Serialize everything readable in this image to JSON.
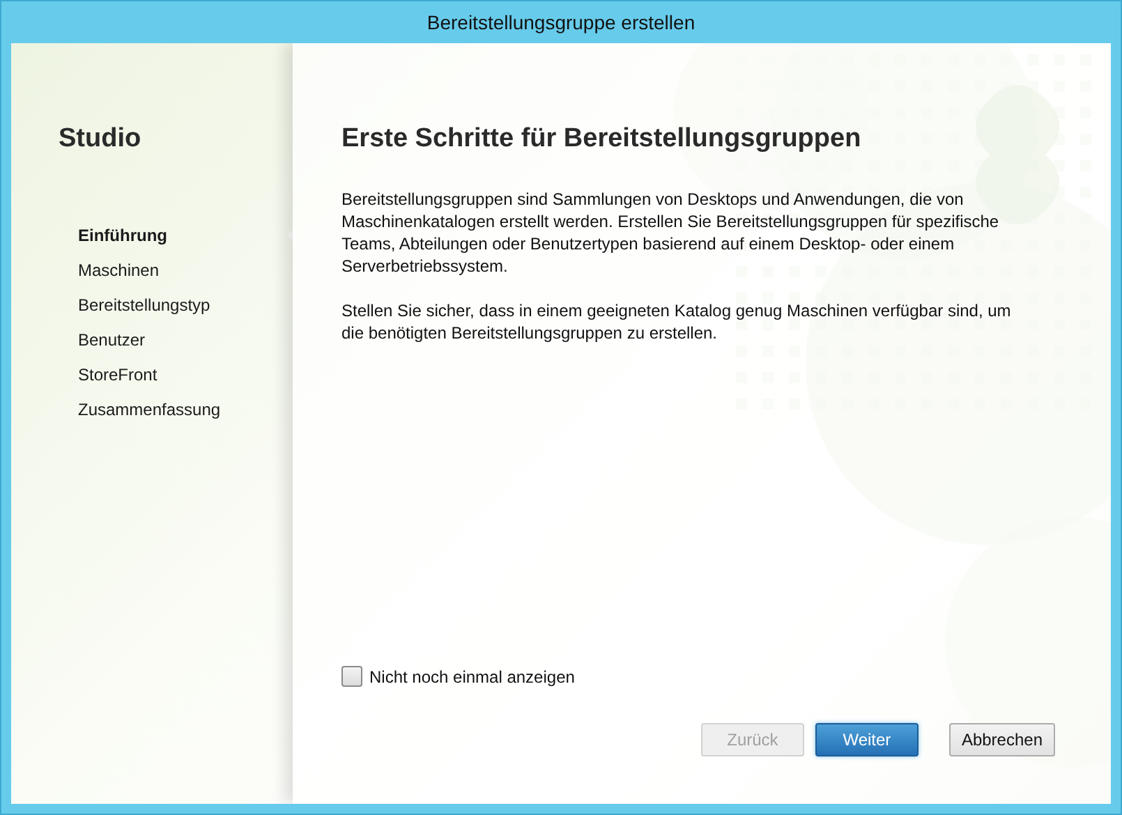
{
  "window": {
    "title": "Bereitstellungsgruppe erstellen"
  },
  "sidebar": {
    "title": "Studio",
    "items": [
      {
        "label": "Einführung",
        "selected": true
      },
      {
        "label": "Maschinen",
        "selected": false
      },
      {
        "label": "Bereitstellungstyp",
        "selected": false
      },
      {
        "label": "Benutzer",
        "selected": false
      },
      {
        "label": "StoreFront",
        "selected": false
      },
      {
        "label": "Zusammenfassung",
        "selected": false
      }
    ]
  },
  "page": {
    "heading": "Erste Schritte für Bereitstellungsgruppen",
    "paragraphs": [
      "Bereitstellungsgruppen sind Sammlungen von Desktops und Anwendungen, die von Maschinenkatalogen erstellt werden. Erstellen Sie Bereitstellungsgruppen für spezifische Teams, Abteilungen oder Benutzertypen basierend auf einem Desktop- oder einem Serverbetriebssystem.",
      "Stellen Sie sicher, dass in einem geeigneten Katalog genug Maschinen verfügbar sind, um die benötigten Bereitstellungsgruppen zu erstellen."
    ],
    "checkbox": {
      "label": "Nicht noch einmal anzeigen",
      "checked": false
    }
  },
  "buttons": [
    {
      "label": "Zurück",
      "kind": "secondary",
      "disabled": true
    },
    {
      "label": "Weiter",
      "kind": "primary",
      "disabled": false
    },
    {
      "label": "Abbrechen",
      "kind": "secondary",
      "disabled": false
    }
  ]
}
